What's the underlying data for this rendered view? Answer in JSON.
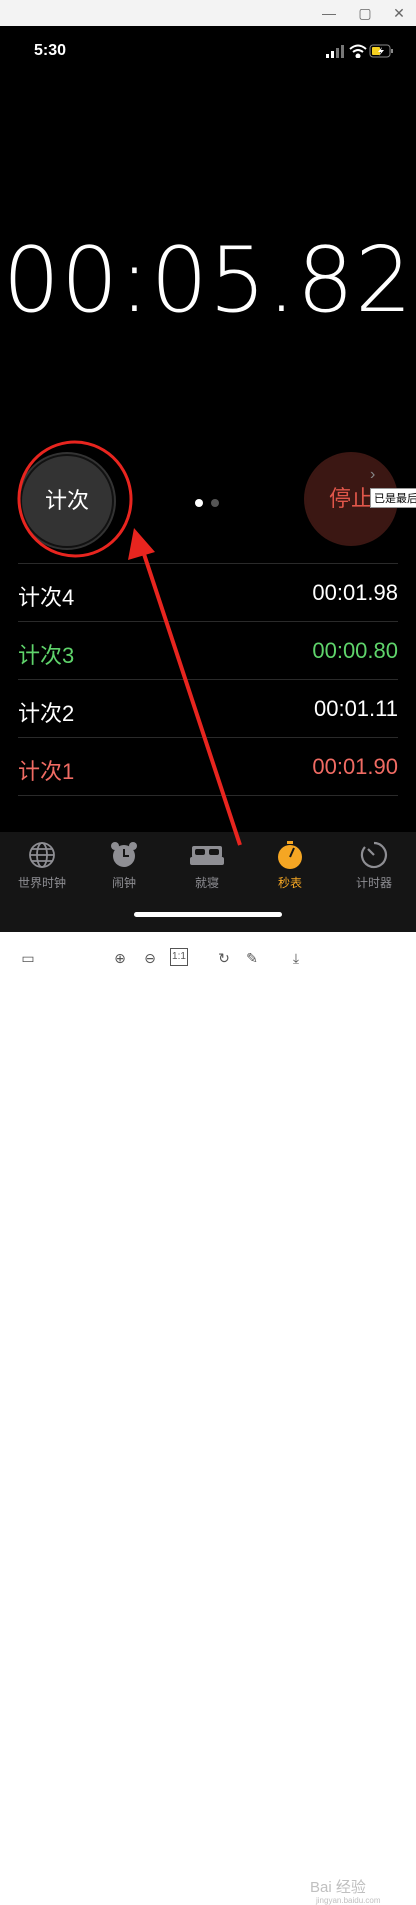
{
  "status_bar": {
    "time": "5:30"
  },
  "stopwatch": {
    "display": "00:05.82",
    "lap_button": "计次",
    "stop_button": "停止",
    "tooltip": "已是最后"
  },
  "laps": [
    {
      "label": "计次4",
      "time": "00:01.98",
      "color": "#ffffff"
    },
    {
      "label": "计次3",
      "time": "00:00.80",
      "color": "#5fd46b"
    },
    {
      "label": "计次2",
      "time": "00:01.11",
      "color": "#ffffff"
    },
    {
      "label": "计次1",
      "time": "00:01.90",
      "color": "#f06b63"
    }
  ],
  "tabbar": {
    "items": [
      {
        "label": "世界时钟",
        "icon": "globe-icon",
        "active": false
      },
      {
        "label": "闹钟",
        "icon": "alarm-clock-icon",
        "active": false
      },
      {
        "label": "就寝",
        "icon": "bed-icon",
        "active": false
      },
      {
        "label": "秒表",
        "icon": "stopwatch-icon",
        "active": true
      },
      {
        "label": "计时器",
        "icon": "timer-icon",
        "active": false
      }
    ]
  },
  "watermark": {
    "text": "Bai 经验",
    "sub": "jingyan.baidu.com"
  },
  "colors": {
    "active_tab": "#f5a623",
    "inactive_tab": "#8e8e93",
    "stop_red": "#e0564a",
    "annotation_red": "#e8251f"
  }
}
